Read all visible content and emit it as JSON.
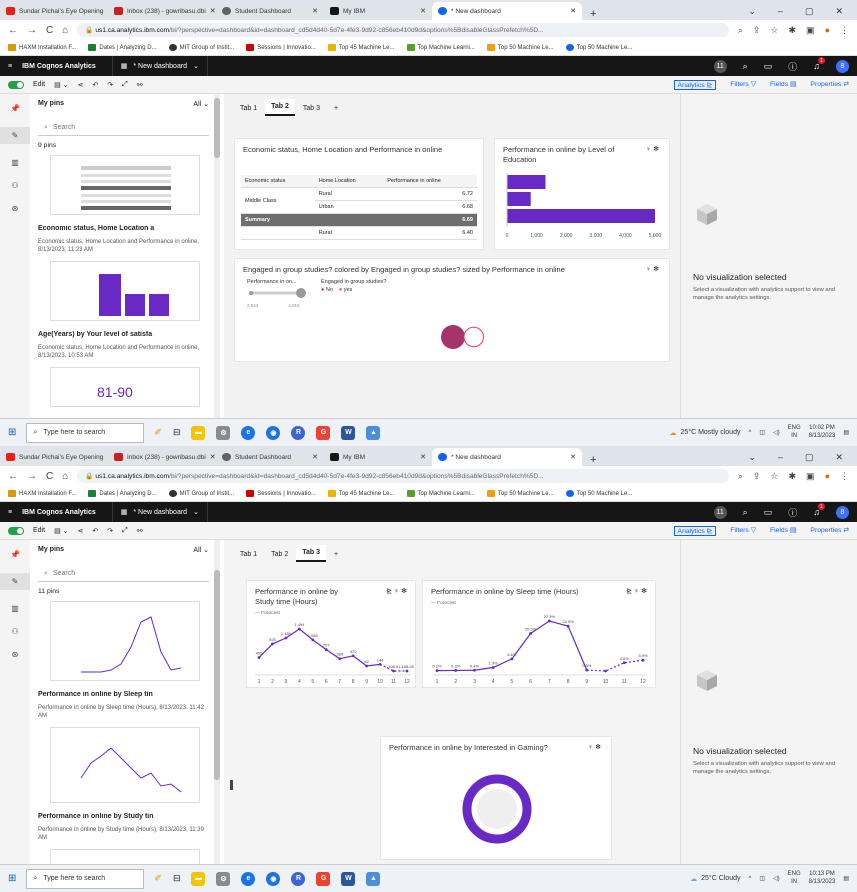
{
  "browser_tabs": [
    {
      "label": "Sundar Pichai's Eye Opening",
      "color": "#e62117"
    },
    {
      "label": "Inbox (238) - gowribasu.dbi",
      "color": "#c5221f"
    },
    {
      "label": "Student Dashboard",
      "color": "#5f6368"
    },
    {
      "label": "My IBM",
      "color": "#161616"
    },
    {
      "label": "* New dashboard",
      "color": "#0f62fe"
    }
  ],
  "address": {
    "host": "us1.ca.analytics.ibm.com",
    "rest": "/bi/?perspective=dashboard&id=dashboard_cd5d4d40-5d7e-4fe3-9d92-c856eb410d9d&options%5BdisableGlassPrefetch%5D..."
  },
  "bookmarks": [
    {
      "label": "HAXM Installation F...",
      "color": "#d99a00"
    },
    {
      "label": "Dates | Analyzing D...",
      "color": "#1a7f37"
    },
    {
      "label": "MIT Group of Instit...",
      "color": "#333333"
    },
    {
      "label": "Sessions | Innovatio...",
      "color": "#d00000"
    },
    {
      "label": "Top 45 Machine Le...",
      "color": "#e8b600"
    },
    {
      "label": "Top Machine Learni...",
      "color": "#5aa02c"
    },
    {
      "label": "Top 50 Machine Le...",
      "color": "#f59e0b"
    },
    {
      "label": "Top 50 Machine Le...",
      "color": "#0f62fe"
    }
  ],
  "cognos": {
    "brand": "IBM Cognos Analytics",
    "dashboard": "* New dashboard",
    "avatar": "8",
    "bell_count": "1",
    "help_badge": "11"
  },
  "toolbar": {
    "edit": "Edit",
    "analytics": "Analytics",
    "filters": "Filters",
    "fields": "Fields",
    "properties": "Properties"
  },
  "pins": {
    "title": "My pins",
    "filter": "All",
    "search_placeholder": "Search"
  },
  "shot1": {
    "pin_count": "9 pins",
    "pin1_title": "Economic status, Home Location a",
    "pin1_sub": "Economic status, Home Location and Performance in online, 8/13/2023, 11:23 AM",
    "pin2_title": "Age(Years) by Your level of satisfa",
    "pin2_sub": "Economic status, Home Location and Performance in online, 8/13/2023, 10:53 AM",
    "pin3_value": "81-90",
    "tabs": [
      "Tab 1",
      "Tab 2",
      "Tab 3",
      "+"
    ],
    "active_tab": 1,
    "table_widget": {
      "title": "Economic status, Home Location and Performance in online",
      "headers": [
        "Economic status",
        "Home Location",
        "Performance in online"
      ],
      "group": "Middle Class",
      "rows": [
        {
          "location": "Rural",
          "value": "6.72"
        },
        {
          "location": "Urban",
          "value": "6.68"
        }
      ],
      "summary": {
        "label": "Summary",
        "value": "6.69"
      },
      "partial": {
        "location": "Rural",
        "value": "6.40"
      }
    },
    "bar_widget": {
      "title": "Performance in online by Level of Education"
    },
    "bubble_widget": {
      "title": "Engaged in group studies? colored by Engaged in group studies? sized by Performance in online",
      "legend_size_label": "Performance in on...",
      "legend_size_min": "2,644",
      "legend_size_max": "4,016",
      "legend_color_label": "Engaged in group studies?",
      "legend_no": "No",
      "legend_yes": "yes"
    },
    "no_vis_title": "No visualization selected",
    "no_vis_desc": "Select a visualization with analytics support to view and manage the analytics settings.",
    "weather": "25°C  Mostly cloudy",
    "time": "10:02 PM",
    "date": "8/13/2023"
  },
  "shot2": {
    "pin_count": "11 pins",
    "pin1_title": "Performance in online by Sleep tin",
    "pin1_sub": "Performance in online by Sleep time (Hours), 8/13/2023, 11:42 AM",
    "pin2_title": "Performance in online by Study tin",
    "pin2_sub": "Performance in online by Study time (Hours), 8/13/2023, 11:39 AM",
    "tabs": [
      "Tab 1",
      "Tab 2",
      "Tab 3",
      "+"
    ],
    "active_tab": 2,
    "study_widget": {
      "title": "Performance in online by Study time (Hours)",
      "legend": "Forecast"
    },
    "sleep_widget": {
      "title": "Performance in online by Sleep time (Hours)",
      "legend": "Forecast"
    },
    "gaming_widget": {
      "title": "Performance in online by Interested in Gaming?"
    },
    "no_vis_title": "No visualization selected",
    "no_vis_desc": "Select a visualization with analytics support to view and manage the analytics settings.",
    "weather": "25°C  Cloudy",
    "time": "10:13 PM",
    "date": "8/13/2023"
  },
  "taskbar": {
    "search_placeholder": "Type here to search",
    "lang": "ENG",
    "region": "IN"
  },
  "chart_data": [
    {
      "type": "bar",
      "title": "Performance in online by Level of Education",
      "orientation": "horizontal",
      "categories": [
        "",
        "",
        ""
      ],
      "values": [
        1300,
        800,
        5000
      ],
      "xticks": [
        "0",
        "1,000",
        "2,000",
        "3,000",
        "4,000",
        "5,000"
      ],
      "xlim": [
        0,
        5000
      ],
      "color": "#6929c4"
    },
    {
      "type": "scatter",
      "title": "Engaged in group studies? colored by Engaged in group studies? sized by Performance in online",
      "series": [
        {
          "name": "No",
          "value": 4016,
          "color": "#a7336d"
        },
        {
          "name": "yes",
          "value": 2644,
          "color": "#e83b5d"
        }
      ]
    },
    {
      "type": "line",
      "title": "Performance in online by Study time (Hours)",
      "x": [
        1,
        2,
        3,
        4,
        5,
        6,
        7,
        8,
        9,
        10,
        11,
        12
      ],
      "values": [
        405,
        925,
        1150,
        1494,
        1080,
        707,
        360,
        470,
        82,
        144,
        -108.51,
        -108.28
      ],
      "labels": [
        "405",
        "925",
        "1,150",
        "1,494",
        "1,080",
        "707",
        "360",
        "470",
        "82",
        "144",
        "-108.51",
        "-108.28"
      ],
      "forecast_from": 10,
      "color": "#6929c4"
    },
    {
      "type": "line",
      "title": "Performance in online by Sleep time (Hours)",
      "x": [
        1,
        2,
        3,
        4,
        5,
        6,
        7,
        8,
        9,
        10,
        11,
        12
      ],
      "values": [
        0.2,
        0.3,
        0.4,
        1.9,
        6.6,
        20.5,
        27.3,
        24.5,
        0.5,
        0,
        4.5,
        5.9
      ],
      "labels": [
        "0.2%",
        "0.3%",
        "0.4%",
        "1.9%",
        "6.6%",
        "20.5%",
        "27.3%",
        "24.5%",
        "0.5%",
        "",
        "4.5%",
        "5.9%"
      ],
      "forecast_from": 9,
      "color": "#6929c4"
    },
    {
      "type": "pie",
      "title": "Performance in online by Interested in Gaming?",
      "values": [
        100
      ],
      "color": "#6929c4"
    }
  ]
}
